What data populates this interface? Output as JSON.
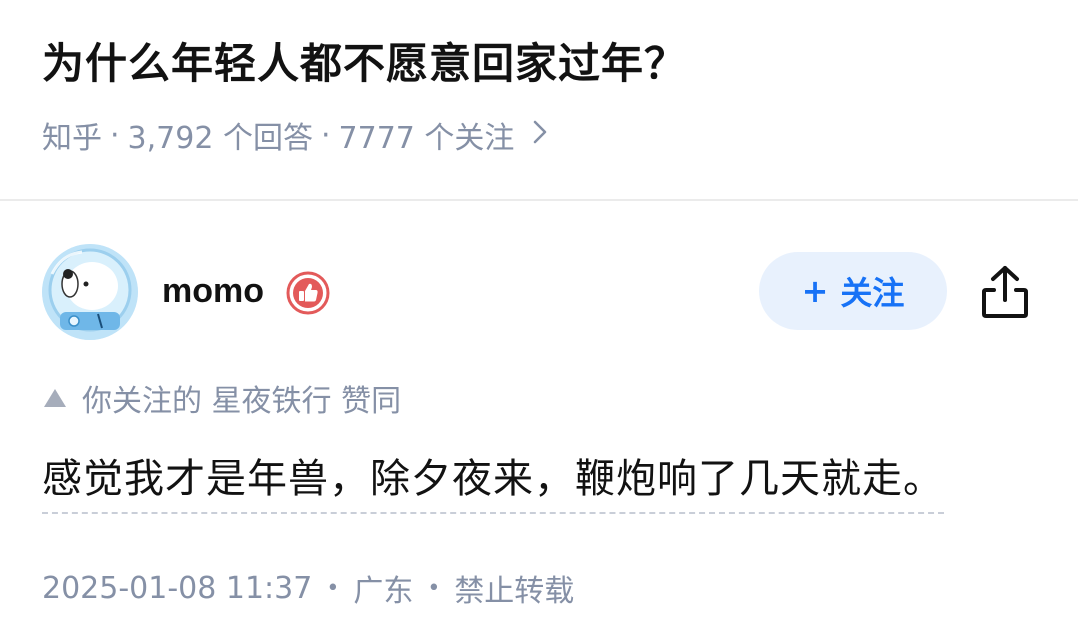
{
  "question": {
    "title": "为什么年轻人都不愿意回家过年？",
    "source": "知乎",
    "answers_count": "3,792 个回答",
    "followers_count": "7777 个关注",
    "separator": "·"
  },
  "author": {
    "name": "momo",
    "follow_label": "关注",
    "follow_plus": "+",
    "follow_color": "#1772f6",
    "badge_color": "#e35a5a",
    "icons": {
      "avatar": "astronaut-dog-avatar",
      "badge": "thumbs-up-badge-icon",
      "share": "share-icon"
    }
  },
  "endorsement": {
    "text": "你关注的 星夜铁行 赞同",
    "icon": "triangle-up-icon"
  },
  "answer": {
    "content": "感觉我才是年兽，除夕夜来，鞭炮响了几天就走。"
  },
  "footer": {
    "timestamp": "2025-01-08 11:37",
    "location": "广东",
    "repost_policy": "禁止转载",
    "dot": "•"
  }
}
